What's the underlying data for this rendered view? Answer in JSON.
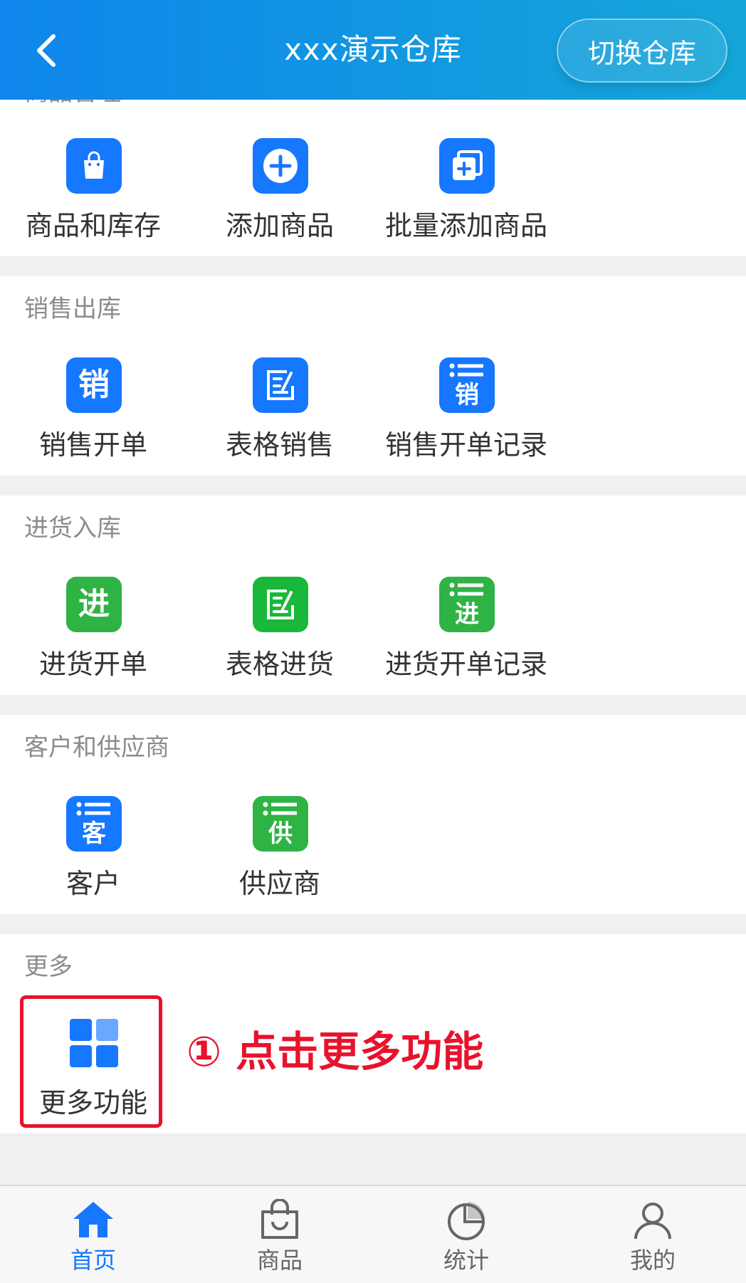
{
  "header": {
    "title": "xxx演示仓库",
    "switch_label": "切换仓库"
  },
  "sections": [
    {
      "title": "商品管理",
      "items": [
        {
          "label": "商品和库存",
          "icon": "shopping-bag-icon"
        },
        {
          "label": "添加商品",
          "icon": "add-circle-icon"
        },
        {
          "label": "批量添加商品",
          "icon": "batch-add-icon"
        }
      ]
    },
    {
      "title": "销售出库",
      "items": [
        {
          "label": "销售开单",
          "icon": "sales-order-icon",
          "glyph": "销"
        },
        {
          "label": "表格销售",
          "icon": "form-edit-icon"
        },
        {
          "label": "销售开单记录",
          "icon": "sales-record-icon",
          "glyph": "销"
        }
      ]
    },
    {
      "title": "进货入库",
      "items": [
        {
          "label": "进货开单",
          "icon": "purchase-order-icon",
          "glyph": "进"
        },
        {
          "label": "表格进货",
          "icon": "form-edit-icon"
        },
        {
          "label": "进货开单记录",
          "icon": "purchase-record-icon",
          "glyph": "进"
        }
      ]
    },
    {
      "title": "客户和供应商",
      "items": [
        {
          "label": "客户",
          "icon": "customer-list-icon",
          "glyph": "客"
        },
        {
          "label": "供应商",
          "icon": "supplier-list-icon",
          "glyph": "供"
        }
      ]
    },
    {
      "title": "更多",
      "items": [
        {
          "label": "更多功能",
          "icon": "grid-apps-icon"
        }
      ]
    }
  ],
  "annotation": {
    "text": "① 点击更多功能"
  },
  "bottom_nav": [
    {
      "label": "首页",
      "icon": "home-icon",
      "active": true
    },
    {
      "label": "商品",
      "icon": "shopping-bag-icon",
      "active": false
    },
    {
      "label": "统计",
      "icon": "pie-chart-icon",
      "active": false
    },
    {
      "label": "我的",
      "icon": "user-icon",
      "active": false
    }
  ],
  "colors": {
    "header_start": "#0f86ec",
    "header_end": "#14a6d8",
    "blue_icon": "#1677ff",
    "green_icon": "#2fb344",
    "active_nav": "#1677ff",
    "inactive_nav": "#666666",
    "annotation": "#e8122c",
    "section_title": "#8c8c8c"
  }
}
